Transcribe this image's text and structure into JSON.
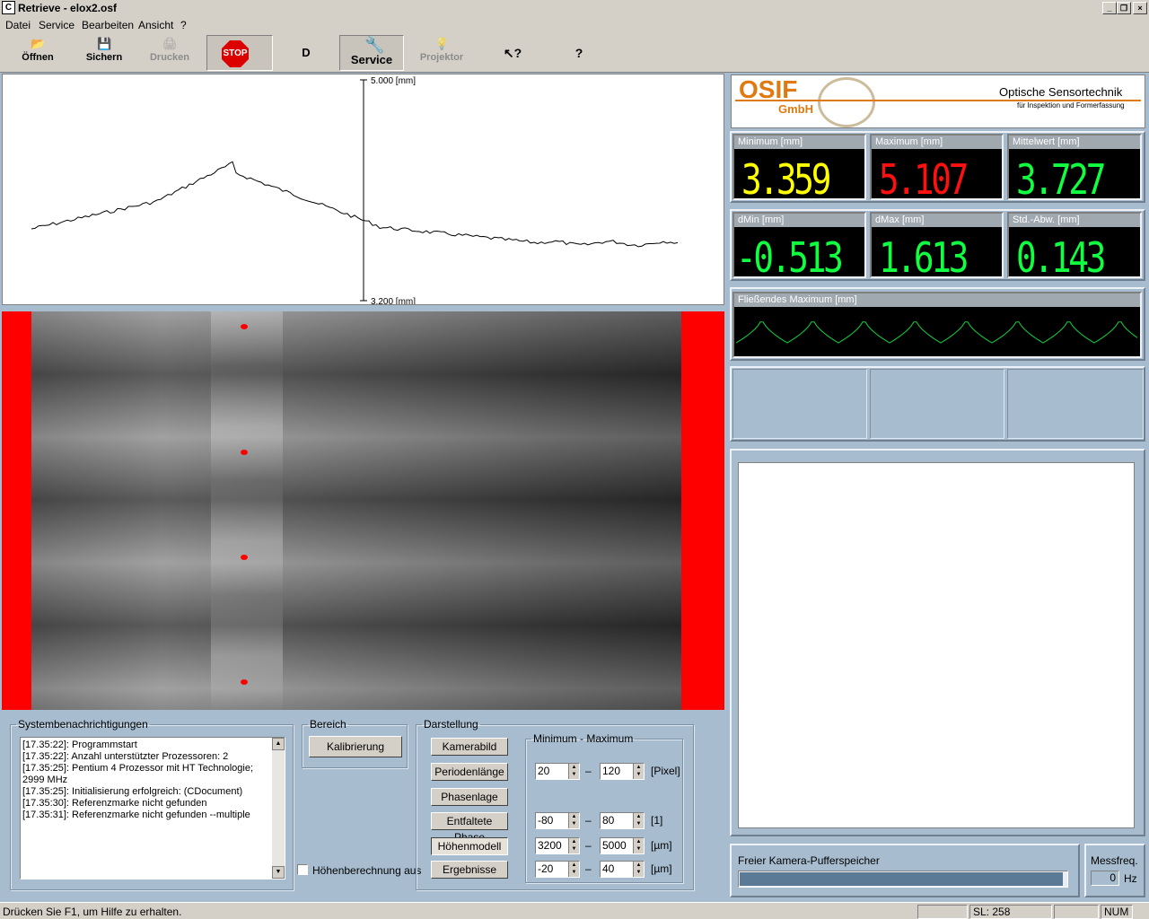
{
  "window": {
    "title": "Retrieve - elox2.osf",
    "app_icon": "C"
  },
  "menu": [
    "Datei",
    "Service",
    "Bearbeiten",
    "Ansicht",
    "?"
  ],
  "toolbar": {
    "open": "Öffnen",
    "save": "Sichern",
    "print": "Drucken",
    "stop": "STOP",
    "d": "D",
    "service": "Service",
    "projector": "Projektor"
  },
  "plot": {
    "top_label": "5.000 [mm]",
    "bottom_label": "3.200 [mm]"
  },
  "logo": {
    "brand": "OSIF",
    "brand_sub": "GmbH",
    "tagline": "Optische Sensortechnik",
    "subtagline": "für Inspektion und Formerfassung"
  },
  "stats": {
    "minimum": {
      "label": "Minimum [mm]",
      "value": "3.359",
      "color": "#ffff00"
    },
    "maximum": {
      "label": "Maximum [mm]",
      "value": "5.107",
      "color": "#ff1010"
    },
    "mean": {
      "label": "Mittelwert [mm]",
      "value": "3.727",
      "color": "#10ff40"
    },
    "dmin": {
      "label": "dMin [mm]",
      "value": "-0.513",
      "color": "#10ff40"
    },
    "dmax": {
      "label": "dMax [mm]",
      "value": "1.613",
      "color": "#10ff40"
    },
    "std": {
      "label": "Std.-Abw. [mm]",
      "value": "0.143",
      "color": "#10ff40"
    }
  },
  "floating_max": {
    "label": "Fließendes Maximum [mm]"
  },
  "buffer": {
    "label": "Freier Kamera-Pufferspeicher",
    "fill": 0.99
  },
  "freq": {
    "label": "Messfreq.",
    "value": "0",
    "unit": "Hz"
  },
  "system": {
    "legend": "Systembenachrichtigungen",
    "messages": [
      "[17.35:22]: Programmstart",
      "[17.35:22]: Anzahl unterstützter Prozessoren: 2",
      "[17.35:25]: Pentium 4 Prozessor mit HT Technologie; 2999 MHz",
      "[17.35:25]: Initialisierung erfolgreich: (CDocument)",
      "[17.35:30]: Referenzmarke nicht gefunden",
      "[17.35:31]: Referenzmarke nicht gefunden --multiple"
    ]
  },
  "bereich": {
    "legend": "Bereich",
    "calibrate": "Kalibrierung"
  },
  "hoehen_checkbox": "Höhenberechnung aus",
  "darstellung": {
    "legend": "Darstellung",
    "buttons": [
      "Kamerabild",
      "Periodenlänge",
      "Phasenlage",
      "Entfaltete Phase",
      "Höhenmodell",
      "Ergebnisse"
    ],
    "minmax_legend": "Minimum - Maximum",
    "ranges": [
      {
        "min": "20",
        "max": "120",
        "unit": "[Pixel]"
      },
      {
        "min": "-80",
        "max": "80",
        "unit": "[1]"
      },
      {
        "min": "3200",
        "max": "5000",
        "unit": "[µm]"
      },
      {
        "min": "-20",
        "max": "40",
        "unit": "[µm]"
      }
    ],
    "dash": "–"
  },
  "status": {
    "hint": "Drücken Sie F1, um Hilfe zu erhalten.",
    "sl": "SL: 258",
    "num": "NUM"
  }
}
